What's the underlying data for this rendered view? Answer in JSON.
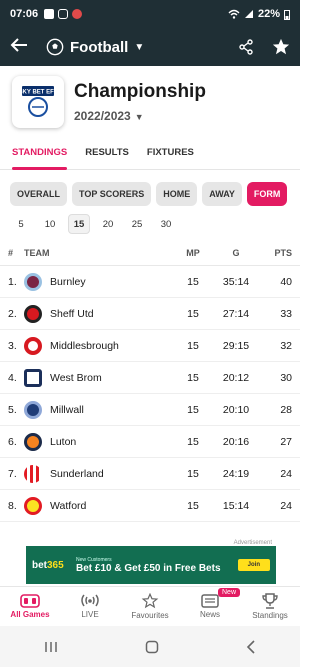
{
  "status": {
    "time": "07:06",
    "battery": "22%"
  },
  "appbar": {
    "title": "Football"
  },
  "league": {
    "name": "Championship",
    "season": "2022/2023",
    "logo_text": "SKY BET EFL"
  },
  "tabs": [
    {
      "label": "STANDINGS",
      "active": true
    },
    {
      "label": "RESULTS",
      "active": false
    },
    {
      "label": "FIXTURES",
      "active": false
    }
  ],
  "chips": [
    {
      "label": "OVERALL",
      "active": false
    },
    {
      "label": "TOP SCORERS",
      "active": false
    },
    {
      "label": "HOME",
      "active": false
    },
    {
      "label": "AWAY",
      "active": false
    },
    {
      "label": "FORM",
      "active": true
    }
  ],
  "nums": [
    "5",
    "10",
    "15",
    "20",
    "25",
    "30"
  ],
  "nums_active": "15",
  "table": {
    "headers": {
      "pos": "#",
      "team": "TEAM",
      "mp": "MP",
      "g": "G",
      "pts": "PTS"
    },
    "rows": [
      {
        "pos": "1.",
        "team": "Burnley",
        "mp": "15",
        "g": "35:14",
        "pts": "40",
        "color": "#7a2444"
      },
      {
        "pos": "2.",
        "team": "Sheff Utd",
        "mp": "15",
        "g": "27:14",
        "pts": "33",
        "color": "#d71920"
      },
      {
        "pos": "3.",
        "team": "Middlesbrough",
        "mp": "15",
        "g": "29:15",
        "pts": "32",
        "color": "#d71920"
      },
      {
        "pos": "4.",
        "team": "West Brom",
        "mp": "15",
        "g": "20:12",
        "pts": "30",
        "color": "#1b2f5a"
      },
      {
        "pos": "5.",
        "team": "Millwall",
        "mp": "15",
        "g": "20:10",
        "pts": "28",
        "color": "#1f3c77"
      },
      {
        "pos": "6.",
        "team": "Luton",
        "mp": "15",
        "g": "20:16",
        "pts": "27",
        "color": "#f58220"
      },
      {
        "pos": "7.",
        "team": "Sunderland",
        "mp": "15",
        "g": "24:19",
        "pts": "24",
        "color": "#e21b23"
      },
      {
        "pos": "8.",
        "team": "Watford",
        "mp": "15",
        "g": "15:14",
        "pts": "24",
        "color": "#fbe122"
      }
    ]
  },
  "ad": {
    "label": "Advertisement",
    "brand_a": "bet",
    "brand_b": "365",
    "customer": "New Customers",
    "offer": "Bet £10 & Get £50 in Free Bets",
    "join": "Join"
  },
  "bottomnav": [
    {
      "label": "All Games",
      "active": true
    },
    {
      "label": "LIVE",
      "active": false
    },
    {
      "label": "Favourites",
      "active": false
    },
    {
      "label": "News",
      "active": false,
      "badge": "New"
    },
    {
      "label": "Standings",
      "active": false
    }
  ],
  "colors": {
    "accent": "#e31b62",
    "appbar": "#1f2f35"
  }
}
